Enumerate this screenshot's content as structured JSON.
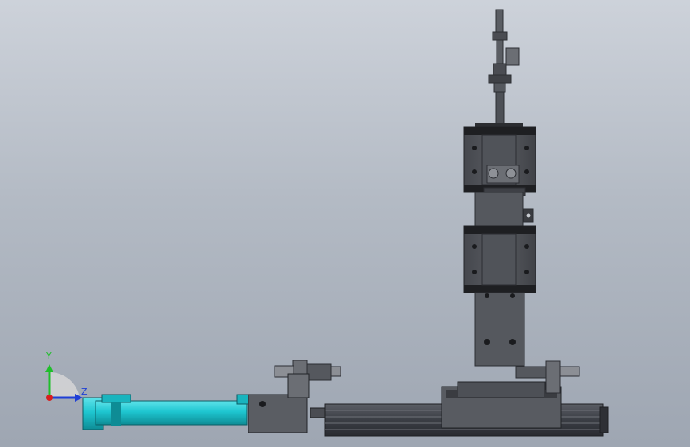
{
  "viewport": {
    "background_top": "#cdd2da",
    "background_bottom": "#9ea6b2"
  },
  "triad": {
    "y_label": "Y",
    "z_label": "Z",
    "y_color": "#1fbf2a",
    "z_color": "#1f3fd6",
    "x_color": "#d81e1e"
  },
  "model": {
    "part_color_dark": "#4a4c52",
    "part_color_mid": "#6b6e74",
    "cylinder_color": "#1ec6d0",
    "rail_color": "#3c3f46"
  }
}
